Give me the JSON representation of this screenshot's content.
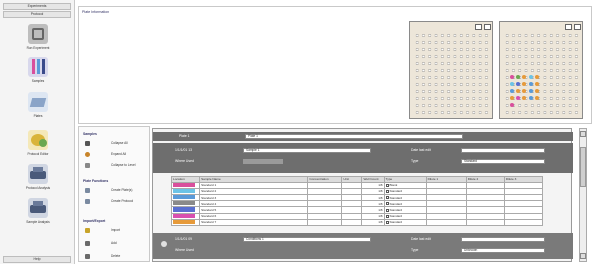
{
  "left_nav": {
    "top_items": [
      "Experiments",
      "Protocol"
    ],
    "items": [
      {
        "label": "Run Experiment",
        "icon": "run-experiment-icon",
        "color": "#7a7a7a"
      },
      {
        "label": "Samples",
        "icon": "samples-icon",
        "color": "#5a5f9a"
      },
      {
        "label": "Plates",
        "icon": "plates-icon",
        "color": "#8aa4c8"
      },
      {
        "label": "Protocol Editor",
        "icon": "protocol-editor-icon",
        "color": "#d9b43a"
      },
      {
        "label": "Protocol Analysis",
        "icon": "protocol-analysis-icon",
        "color": "#4a5a7a"
      },
      {
        "label": "Sample Analysis",
        "icon": "sample-analysis-icon",
        "color": "#4a5a7a"
      }
    ],
    "bottom_label": "Help"
  },
  "sample_info": {
    "title": "Plate Information",
    "plate_buttons": [
      "1",
      "2"
    ]
  },
  "actions": {
    "sections": [
      {
        "title": "Samples",
        "items": [
          "Collapse All",
          "Expand All",
          "Collapse to Level"
        ]
      },
      {
        "title": "Plate Functions",
        "items": [
          "Create Plate(s)",
          "Create Protocol"
        ]
      },
      {
        "title": "Import/Export",
        "items": [
          "Import",
          "Add",
          "Delete"
        ]
      }
    ]
  },
  "detail": {
    "plate_label": "Plate 1",
    "plate_name": "Plate 1",
    "row1": {
      "label": "1/1/1/01 13",
      "value": "Sample 1",
      "right_label": "Date last edit",
      "right_value": ""
    },
    "row2": {
      "label": "Where Used",
      "value": "",
      "right_label": "Type",
      "right_value": "Standard"
    },
    "table": {
      "headers": [
        "Location",
        "Sample Name",
        "Concentration",
        "Unit",
        "Well Count",
        "Type",
        "Dilute 1",
        "Dilute 2",
        "Dilute 3"
      ],
      "rows": [
        {
          "swatch": "#d94f9c",
          "name": "Standard 1",
          "count": "1/8",
          "type": "Blank"
        },
        {
          "swatch": "#6cc3e6",
          "name": "Standard 2",
          "count": "1/8",
          "type": "Standard"
        },
        {
          "swatch": "#5a9ad8",
          "name": "Standard 3",
          "count": "1/8",
          "type": "Standard"
        },
        {
          "swatch": "#8a8a8a",
          "name": "Standard 4",
          "count": "1/8",
          "type": "Standard"
        },
        {
          "swatch": "#5a6fd0",
          "name": "Standard 5",
          "count": "1/8",
          "type": "Standard"
        },
        {
          "swatch": "#d94fb0",
          "name": "Standard 6",
          "count": "1/8",
          "type": "Standard"
        },
        {
          "swatch": "#e69a3a",
          "name": "Standard 7",
          "count": "1/8",
          "type": "Standard"
        }
      ]
    },
    "footer": {
      "label": "1/1/1/01 09",
      "value": "Conditions 1",
      "right_label": "Date last edit",
      "right_value": "",
      "where_used": "Where Used",
      "type_label": "Type",
      "type_value": "Unknown"
    }
  },
  "colors": {
    "accent": "#6e6e6e",
    "panel_border": "#c9c9c9"
  }
}
